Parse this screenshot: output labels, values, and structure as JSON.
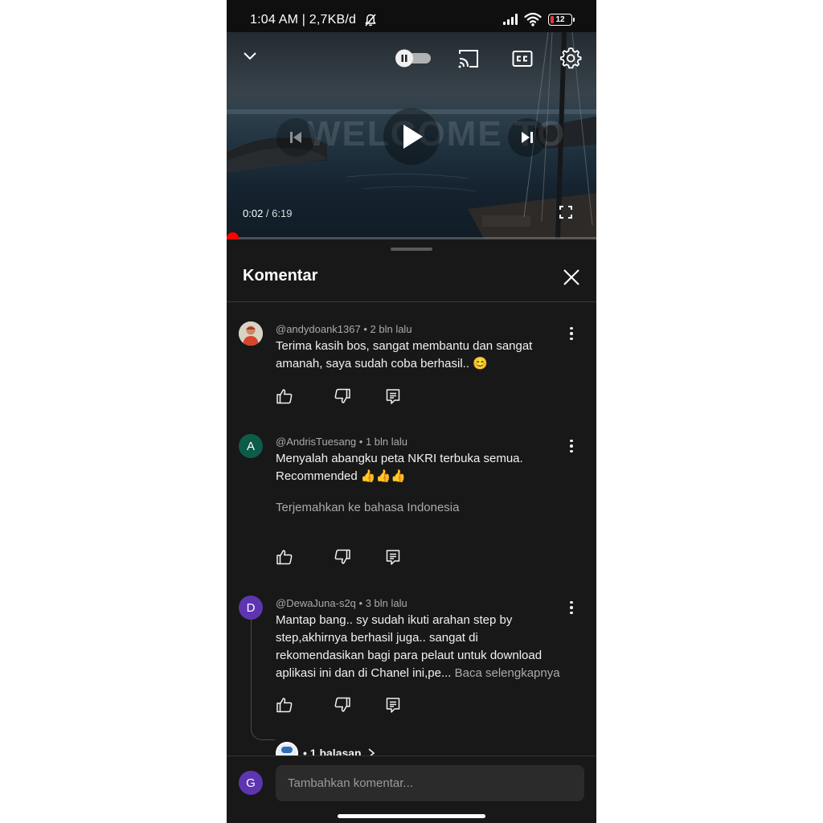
{
  "status_bar": {
    "time": "1:04 AM | 2,7KB/d",
    "battery": "12",
    "icons": [
      "bell-off-icon",
      "signal-icon",
      "wifi-icon",
      "battery-icon"
    ]
  },
  "player": {
    "current_time": "0:02",
    "separator": " / ",
    "duration": "6:19",
    "progress_fraction": 0.005,
    "autoplay": "on",
    "icons": [
      "chevron-down-icon",
      "autoplay-toggle",
      "cast-icon",
      "cc-icon",
      "settings-icon",
      "previous-icon",
      "play-icon",
      "next-icon",
      "fullscreen-icon"
    ],
    "accent_color": "#ff0000"
  },
  "comments_panel": {
    "title": "Komentar",
    "comments": [
      {
        "author": "@andydoank1367",
        "age": "2 bln lalu",
        "text": "Terima kasih bos, sangat membantu dan sangat amanah, saya sudah coba berhasil.. 😊",
        "avatar_letter": ""
      },
      {
        "author": "@AndrisTuesang",
        "age": "1 bln lalu",
        "text": "Menyalah abangku peta NKRI terbuka semua. Recommended 👍👍👍",
        "translate": "Terjemahkan ke bahasa Indonesia",
        "avatar_letter": "A",
        "avatar_color": "#0d5c4a"
      },
      {
        "author": "@DewaJuna-s2q",
        "age": "3 bln lalu",
        "text": "Mantap bang.. sy sudah ikuti arahan step by step,akhirnya berhasil juga.. sangat di rekomendasikan bagi para pelaut untuk download aplikasi ini dan di Chanel ini,pe...",
        "read_more": "Baca selengkapnya",
        "replies": "• 1 balasan",
        "avatar_letter": "D",
        "avatar_color": "#5e35b1"
      }
    ]
  },
  "composer": {
    "avatar_letter": "G",
    "placeholder": "Tambahkan komentar..."
  }
}
